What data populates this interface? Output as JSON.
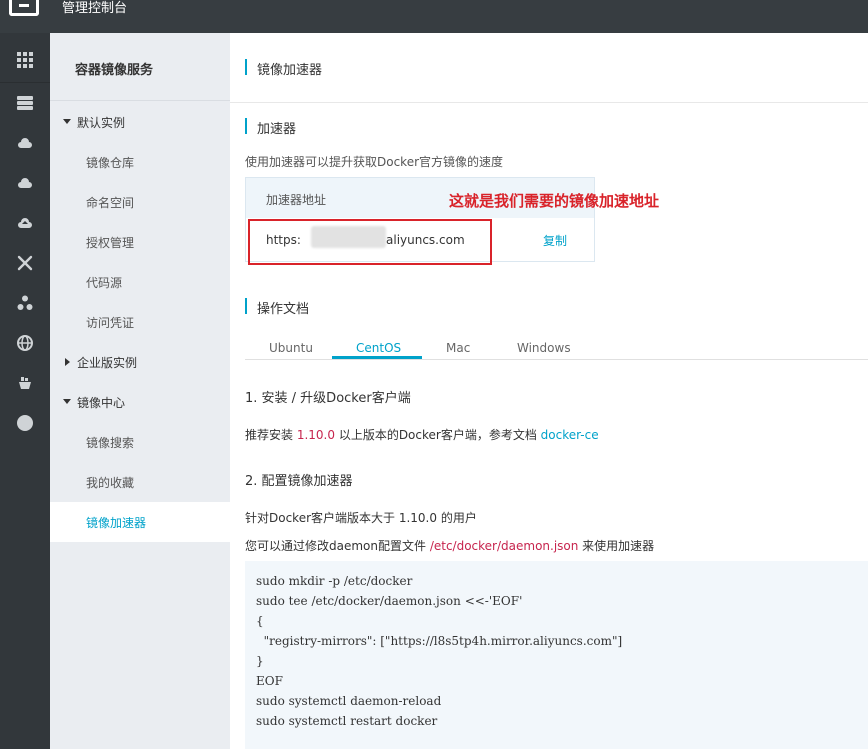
{
  "topbar": {
    "title": "管理控制台",
    "logo": "aliyun-logo"
  },
  "rail": {
    "icons": [
      "grid-icon",
      "database-icon",
      "cloud-shield-icon",
      "cloud-icon",
      "cloud-upload-icon",
      "network-icon",
      "cluster-icon",
      "globe-icon",
      "container-icon",
      "circle-icon"
    ]
  },
  "sidebar": {
    "title": "容器镜像服务",
    "groups": [
      {
        "label": "默认实例",
        "expanded": true
      },
      {
        "label": "企业版实例",
        "expanded": false
      },
      {
        "label": "镜像中心",
        "expanded": true
      }
    ],
    "items": [
      "镜像仓库",
      "命名空间",
      "授权管理",
      "代码源",
      "访问凭证",
      "镜像搜索",
      "我的收藏",
      "镜像加速器"
    ],
    "active_item": "镜像加速器"
  },
  "main": {
    "page_title": "镜像加速器",
    "accelerator": {
      "section_title": "加速器",
      "description": "使用加速器可以提升获取Docker官方镜像的速度",
      "header_label": "加速器地址",
      "url_prefix": "https:",
      "url_suffix": "aliyuncs.com",
      "copy_label": "复制",
      "annotation": "这就是我们需要的镜像加速地址"
    },
    "docs": {
      "section_title": "操作文档",
      "tabs": [
        "Ubuntu",
        "CentOS",
        "Mac",
        "Windows"
      ],
      "active_tab": "CentOS",
      "step1_title": "1. 安装 / 升级Docker客户端",
      "step1_pre": "推荐安装 ",
      "step1_version": "1.10.0",
      "step1_mid": " 以上版本的Docker客户端，参考文档 ",
      "step1_link": "docker-ce",
      "step2_title": "2. 配置镜像加速器",
      "step2_line1": "针对Docker客户端版本大于 1.10.0 的用户",
      "step2_line2_pre": "您可以通过修改daemon配置文件 ",
      "step2_path": "/etc/docker/daemon.json",
      "step2_line2_post": " 来使用加速器",
      "code": [
        "sudo mkdir -p /etc/docker",
        "sudo tee /etc/docker/daemon.json <<-'EOF'",
        "{",
        "  \"registry-mirrors\": [\"https://l8s5tp4h.mirror.aliyuncs.com\"]",
        "}",
        "EOF",
        "sudo systemctl daemon-reload",
        "sudo systemctl restart docker"
      ]
    }
  },
  "colors": {
    "accent": "#00a2ca",
    "highlight": "#c7254e",
    "annotation": "#d9232a",
    "topbar": "#373d41"
  }
}
